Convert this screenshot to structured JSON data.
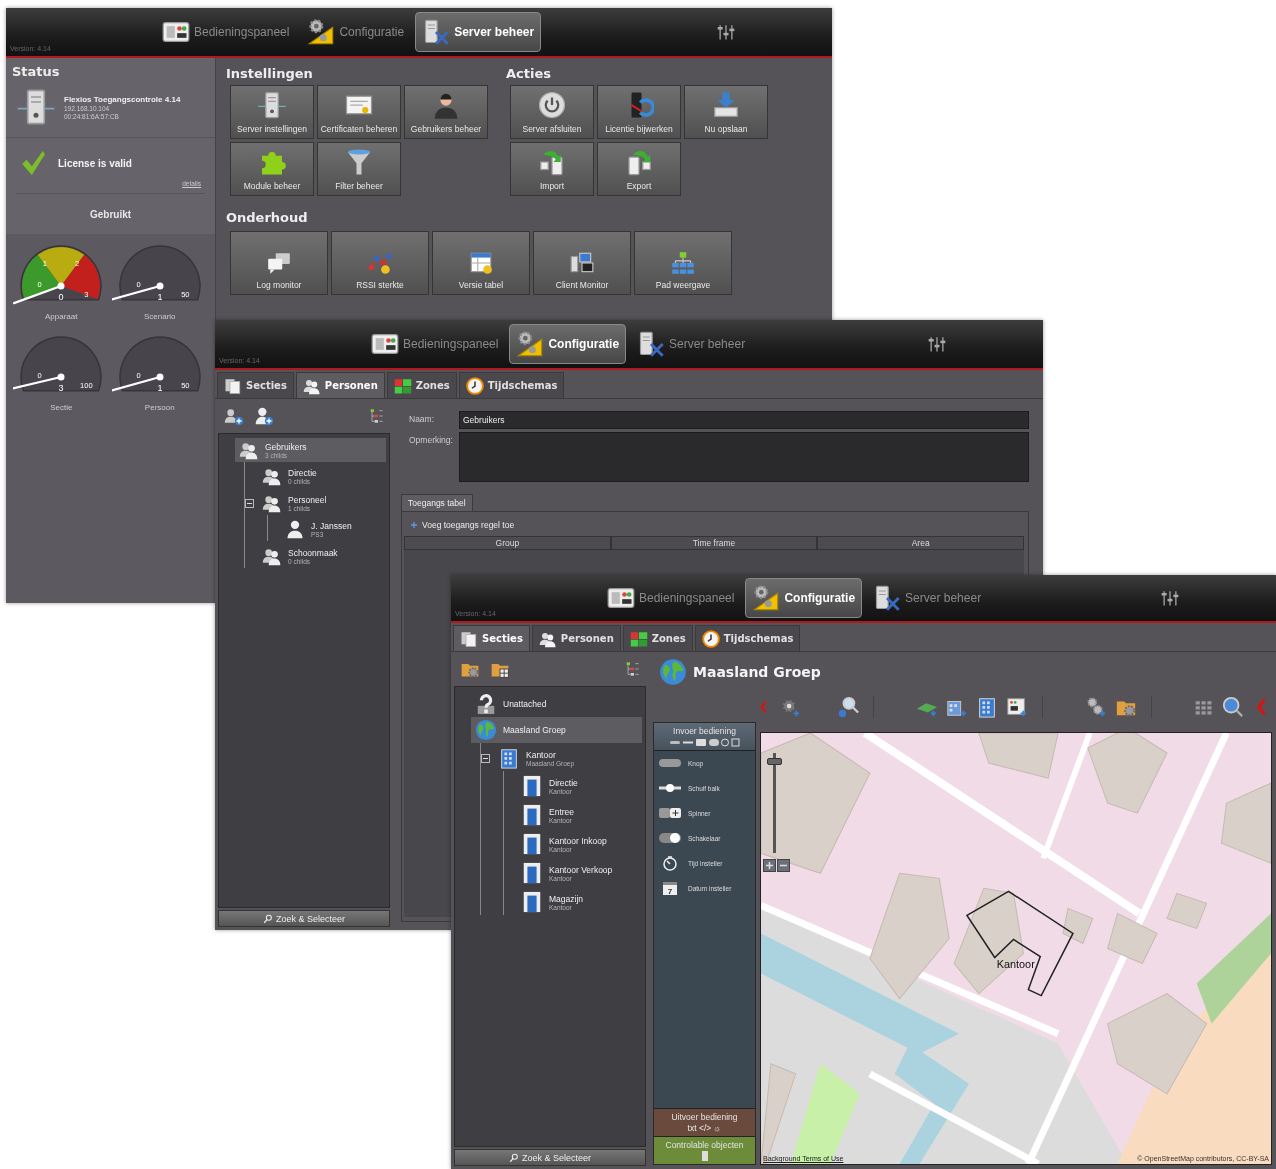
{
  "windows": [
    {
      "kind": "server",
      "version": "Version: 4.14",
      "nav": [
        {
          "kind": "dashboard",
          "label": "Bedieningspaneel",
          "selected": false
        },
        {
          "kind": "config",
          "label": "Configuratie",
          "selected": false
        },
        {
          "kind": "servertools",
          "label": "Server beheer",
          "selected": true
        }
      ],
      "status": {
        "title": "Status",
        "server": {
          "name": "Flexios Toegangscontrole 4.14",
          "ip": "192.168.10.104",
          "mac": "00:24:81:6A:57:CB"
        },
        "license": {
          "text": "License is valid",
          "link": "details"
        },
        "used_title": "Gebruikt",
        "gauges": [
          {
            "label": "Apparaat",
            "kind": "zones",
            "scale": [
              "0",
              "1",
              "2",
              "3"
            ],
            "value": "0"
          },
          {
            "label": "Scenario",
            "kind": "plain",
            "scale": [
              "0",
              "50"
            ],
            "value": "1"
          },
          {
            "label": "Sectie",
            "kind": "plain",
            "scale": [
              "0",
              "100"
            ],
            "value": "3"
          },
          {
            "label": "Persoon",
            "kind": "plain",
            "scale": [
              "0",
              "50"
            ],
            "value": "1"
          }
        ]
      },
      "sections": [
        {
          "title": "Instellingen",
          "buttons": [
            {
              "kind": "server",
              "label": "Server instellingen"
            },
            {
              "kind": "certificate",
              "label": "Certificaten beheren"
            },
            {
              "kind": "user",
              "label": "Gebruikers beheer"
            },
            {
              "kind": "puzzle",
              "label": "Module beheer"
            },
            {
              "kind": "funnel",
              "label": "Filter beheer"
            }
          ]
        },
        {
          "title": "Acties",
          "buttons": [
            {
              "kind": "power",
              "label": "Server afsluiten"
            },
            {
              "kind": "license",
              "label": "Licentie bijwerken"
            },
            {
              "kind": "save",
              "label": "Nu opslaan"
            },
            {
              "kind": "import",
              "label": "Import"
            },
            {
              "kind": "export",
              "label": "Export"
            }
          ]
        },
        {
          "title": "Onderhoud",
          "buttons": [
            {
              "kind": "chat",
              "label": "Log monitor"
            },
            {
              "kind": "network",
              "label": "RSSI sterkte"
            },
            {
              "kind": "table",
              "label": "Versie tabel"
            },
            {
              "kind": "monitor",
              "label": "Client Monitor"
            },
            {
              "kind": "hierarchy",
              "label": "Pad weergave"
            }
          ]
        }
      ]
    },
    {
      "kind": "personen",
      "version": "Version: 4.14",
      "nav": [
        {
          "kind": "dashboard",
          "label": "Bedieningspaneel",
          "selected": false
        },
        {
          "kind": "config",
          "label": "Configuratie",
          "selected": true
        },
        {
          "kind": "servertools",
          "label": "Server beheer",
          "selected": false
        }
      ],
      "tabs": [
        {
          "kind": "secties",
          "label": "Secties",
          "selected": false
        },
        {
          "kind": "personen",
          "label": "Personen",
          "selected": true
        },
        {
          "kind": "zones",
          "label": "Zones",
          "selected": false
        },
        {
          "kind": "tijdschemas",
          "label": "Tijdschemas",
          "selected": false
        }
      ],
      "tree": [
        {
          "kind": "group",
          "label": "Gebruikers",
          "sub": "3 childs",
          "selected": true,
          "children": [
            {
              "kind": "group",
              "label": "Directie",
              "sub": "0 childs",
              "selected": false
            },
            {
              "kind": "group",
              "label": "Personeel",
              "sub": "1 childs",
              "selected": false,
              "expanded": true,
              "children": [
                {
                  "kind": "person",
                  "label": "J. Janssen",
                  "sub": "PS3",
                  "selected": false
                }
              ]
            },
            {
              "kind": "group",
              "label": "Schoonmaak",
              "sub": "0 childs",
              "selected": false
            }
          ]
        }
      ],
      "search_button": "Zoek & Selecteer",
      "form": [
        {
          "kind": "line",
          "label": "Naam:",
          "value": "Gebruikers"
        },
        {
          "kind": "area",
          "label": "Opmerking:"
        }
      ],
      "panel": {
        "tab": "Toegangs tabel",
        "add_link": "Voeg toegangs regel toe",
        "columns": [
          "Group",
          "Time frame",
          "Area"
        ]
      }
    },
    {
      "kind": "secties",
      "version": "Version: 4.14",
      "nav": [
        {
          "kind": "dashboard",
          "label": "Bedieningspaneel",
          "selected": false
        },
        {
          "kind": "config",
          "label": "Configuratie",
          "selected": true
        },
        {
          "kind": "servertools",
          "label": "Server beheer",
          "selected": false
        }
      ],
      "tabs": [
        {
          "kind": "secties",
          "label": "Secties",
          "selected": true
        },
        {
          "kind": "personen",
          "label": "Personen",
          "selected": false
        },
        {
          "kind": "zones",
          "label": "Zones",
          "selected": false
        },
        {
          "kind": "tijdschemas",
          "label": "Tijdschemas",
          "selected": false
        }
      ],
      "tree": [
        {
          "kind": "unknown",
          "label": "Unattached",
          "selected": false
        },
        {
          "kind": "globe",
          "label": "Maasland Groep",
          "selected": true,
          "children": [
            {
              "kind": "building",
              "label": "Kantoor",
              "sub": "Maasland Groep",
              "selected": false,
              "expanded": true,
              "children": [
                {
                  "kind": "door",
                  "label": "Directie",
                  "sub": "Kantoor",
                  "selected": false
                },
                {
                  "kind": "door",
                  "label": "Entree",
                  "sub": "Kantoor",
                  "selected": false
                },
                {
                  "kind": "door",
                  "label": "Kantoor Inkoop",
                  "sub": "Kantoor",
                  "selected": false
                },
                {
                  "kind": "door",
                  "label": "Kantoor Verkoop",
                  "sub": "Kantoor",
                  "selected": false
                },
                {
                  "kind": "door",
                  "label": "Magazijn",
                  "sub": "Kantoor",
                  "selected": false
                }
              ]
            }
          ]
        }
      ],
      "search_button": "Zoek & Selecteer",
      "title": "Maasland Groep",
      "palette": {
        "title": "Invoer bediening",
        "items": [
          {
            "kind": "button",
            "label": "Knop"
          },
          {
            "kind": "slider",
            "label": "Schuif balk"
          },
          {
            "kind": "spinner",
            "label": "Spinner"
          },
          {
            "kind": "switch",
            "label": "Schakelaar"
          },
          {
            "kind": "timer",
            "label": "Tijd insteller"
          },
          {
            "kind": "calendar",
            "label": "Datum insteller",
            "badge": "7"
          }
        ],
        "output": {
          "title": "Uitvoer bediening",
          "hint": "txt </> ☼"
        },
        "objects": {
          "title": "Controlable objecten"
        }
      },
      "map": {
        "zoom": {
          "level": 0.95
        },
        "area_label": "Kantoor",
        "link": "Background Terms of Use",
        "attribution": "© OpenStreetMap contributors, CC-BY-SA"
      }
    }
  ]
}
